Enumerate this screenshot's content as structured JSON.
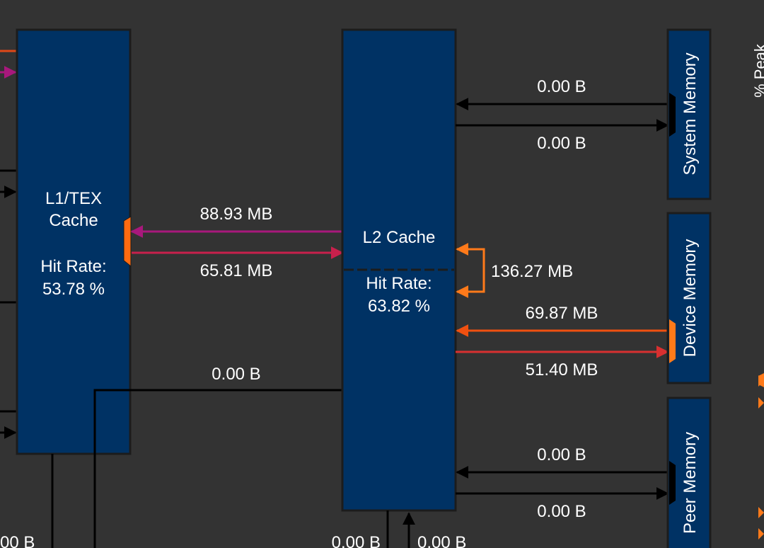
{
  "colors": {
    "background": "#333333",
    "block_fill": "#003264",
    "block_stroke": "#1c1c1c",
    "black_link": "#000000",
    "magenta_link": "#a8187c",
    "crimson_link": "#c8204c",
    "orange_link": "#ff7a1a",
    "dark_orange_link": "#f05010",
    "red_link": "#d83030",
    "port_orange": "#ff6a10"
  },
  "blocks": {
    "l1_tex": {
      "title_line1": "L1/TEX",
      "title_line2": "Cache",
      "hit_label": "Hit Rate:",
      "hit_value": "53.78 %"
    },
    "l2": {
      "title": "L2 Cache",
      "hit_label": "Hit Rate:",
      "hit_value": "63.82 %"
    },
    "system_memory": {
      "label": "System Memory"
    },
    "device_memory": {
      "label": "Device Memory"
    },
    "peer_memory": {
      "label": "Peer Memory"
    }
  },
  "links": {
    "l2_to_l1": "88.93 MB",
    "l1_to_l2": "65.81 MB",
    "l1_l2_bypass": "0.00 B",
    "system_read": "0.00 B",
    "system_write": "0.00 B",
    "l2_loopback": "136.27 MB",
    "device_read": "69.87 MB",
    "device_write": "51.40 MB",
    "peer_read": "0.00 B",
    "peer_write": "0.00 B",
    "bottom_left": "00 B",
    "l2_bottom_left": "0.00 B",
    "l2_bottom_right": "0.00 B"
  },
  "side_label": "% Peak"
}
